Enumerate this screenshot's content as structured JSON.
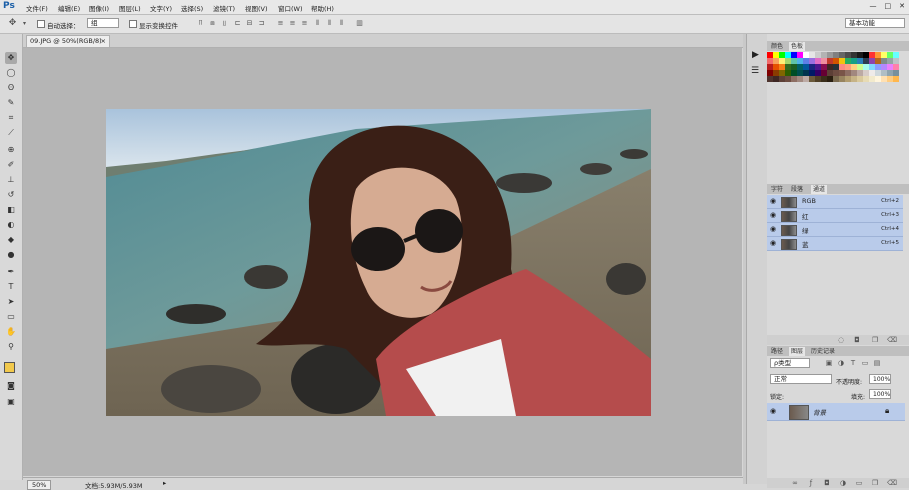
{
  "app": {
    "logo": "Ps"
  },
  "menu": [
    "文件(F)",
    "编辑(E)",
    "图像(I)",
    "图层(L)",
    "文字(Y)",
    "选择(S)",
    "滤镜(T)",
    "视图(V)",
    "窗口(W)",
    "帮助(H)"
  ],
  "window_controls": [
    "—",
    "□",
    "✕"
  ],
  "options": {
    "auto_select_label": "自动选择：",
    "auto_select_value": "组",
    "show_transform_label": "显示变换控件",
    "workspace": "基本功能"
  },
  "document": {
    "tab_title": "09.JPG @ 50%(RGB/8)",
    "close": "×"
  },
  "status": {
    "zoom": "50%",
    "doc_info": "文档:5.93M/5.93M"
  },
  "panels": {
    "color_tabs": [
      "颜色",
      "色板"
    ],
    "channel_tabs": [
      "字符",
      "段落",
      "通道"
    ],
    "channels": [
      {
        "name": "RGB",
        "shortcut": "Ctrl+2"
      },
      {
        "name": "红",
        "shortcut": "Ctrl+3"
      },
      {
        "name": "绿",
        "shortcut": "Ctrl+4"
      },
      {
        "name": "蓝",
        "shortcut": "Ctrl+5"
      }
    ],
    "layer_tabs": [
      "路径",
      "图层",
      "历史记录"
    ],
    "layer_filter": "ρ类型",
    "blend_mode": "正常",
    "opacity_label": "不透明度:",
    "opacity_value": "100%",
    "fill_label": "填充:",
    "fill_value": "100%",
    "lock_label": "锁定:",
    "layer_name": "背景"
  },
  "icons": {
    "eye": "eye-icon",
    "lock": "lock-icon"
  }
}
